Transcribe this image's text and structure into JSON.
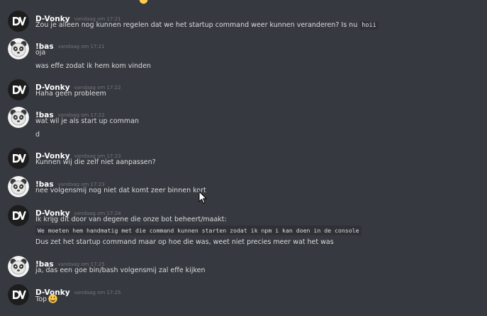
{
  "messages": [
    {
      "author": "D-Vonky",
      "time": "vandaag om 17:21",
      "avatar": "dv-logo",
      "text": "Zou je alleen nog kunnen regelen dat we het startup command weer kunnen veranderen? Is nu",
      "code": "hoii"
    },
    {
      "author": "!bas",
      "time": "vandaag om 17:21",
      "avatar": "panda",
      "lines": [
        "oja",
        "was effe zodat ik hem kom vinden"
      ]
    },
    {
      "author": "D-Vonky",
      "time": "vandaag om 17:22",
      "avatar": "dv-logo",
      "lines": [
        "Haha geen probleem"
      ]
    },
    {
      "author": "!bas",
      "time": "vandaag om 17:22",
      "avatar": "panda",
      "lines": [
        "wat wil je als start up comman",
        "d"
      ]
    },
    {
      "author": "D-Vonky",
      "time": "vandaag om 17:23",
      "avatar": "dv-logo",
      "lines": [
        "Kunnen wij die zelf niet aanpassen?"
      ]
    },
    {
      "author": "!bas",
      "time": "vandaag om 17:23",
      "avatar": "panda",
      "lines": [
        "nee volgensmij nog niet dat komt zeer binnen kort"
      ]
    },
    {
      "author": "D-Vonky",
      "time": "vandaag om 17:24",
      "avatar": "dv-logo",
      "lines": [
        "Ik krijg dit door van degene die onze bot beheert/maakt:"
      ],
      "code": "We moeten hem handmatig met die command kunnen starten zodat ik npm i kan doen in de console",
      "after": "Dus zet het startup command maar op hoe die was, weet niet precies meer wat het was"
    },
    {
      "author": "!bas",
      "time": "vandaag om 17:25",
      "avatar": "panda",
      "lines": [
        "ja, das een goe bin/bash volgensmij zal effe kijken"
      ]
    },
    {
      "author": "D-Vonky",
      "time": "vandaag om 17:25",
      "avatar": "dv-logo",
      "lines": [
        "Top"
      ],
      "emoji": "grinning-emoji"
    }
  ],
  "colors": {
    "background": "#36393f",
    "author": "#ffffff",
    "timestamp": "#72767d",
    "text": "#dcddde",
    "code_background": "#2f3136"
  }
}
